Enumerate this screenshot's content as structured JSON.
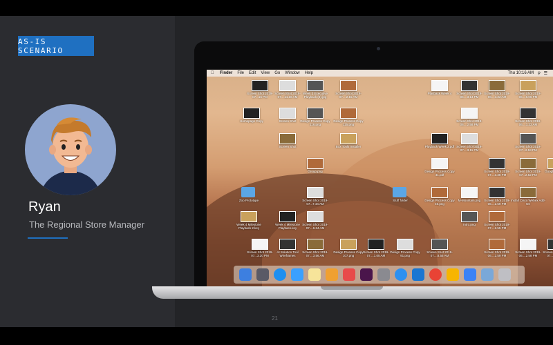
{
  "slide": {
    "tag": "AS-IS SCENARIO",
    "person_name": "Ryan",
    "person_role": "The Regional Store Manager",
    "page_number": "21"
  },
  "menubar": {
    "app_menus": [
      "Finder",
      "File",
      "Edit",
      "View",
      "Go",
      "Window",
      "Help"
    ],
    "clock": "Thu 10:16 AM"
  },
  "desktop": {
    "captions": [
      "Screen Shot 2019-07...16 PM",
      "Screen Shot 2019-07....11.16 AM",
      "Week 3 Executive Playback (3).jpg",
      "Screen Shot 2019-07....2.15 AM",
      "Playback Week 4",
      "Screen Shot 2019-06....3.14 PM",
      "Screen Shot 2019-06....1.22 AM",
      "Screen Shot 2019-06....6.06 PM",
      "Homepage Copy",
      "Screen Shot",
      "Design Process Copy 116.png",
      "Design Process Copy 115.png",
      "Screen Shot 2019-06....2.58 PM",
      "Screen Shot 2019-06....1.23 AM",
      "Screen Shot",
      "Box Tools Installer",
      "Playback Week 2.pdf",
      "Screen Shot 2019-07....3.11 PM",
      "Screen Shot 2019-07...2.53 PM",
      "Group.png",
      "Design Process Copy 41.pdf",
      "Screen Shot 2019-07....3.38 PM",
      "Screen Shot 2019-07...2.52 PM",
      "Google Chrome",
      "Zoo Prototype",
      "Screen Shot 2019-07...7.44 AM",
      "Stuff folder",
      "Design Process Copy 46.png",
      "M-Mountain.png",
      "Screen Shot 2019-06....2.59 PM",
      "Install Cisco Webex Add-On",
      "Week 4 Milestone Playback 2.key",
      "Week 4 Milestone Playback.key",
      "Screen Shot 2019-07....6.34 AM",
      "Intro.png",
      "Screen Shot 2019-07....2.55 PM",
      "Screen Shot 2019-07...3.20 PM",
      "AI Solution Tool Wireframes",
      "Screen Shot 2019-07....3.56 AM",
      "Design Process Copy 107.png",
      "Screen Shot 2019-07....1.05 AM",
      "Design Process Copy 91.png",
      "Screen Shot 2019-07....8.55 AM",
      "Screen Shot 2019-06....2.59 PM",
      "Screen Shot 2019-06....2.58 PM",
      "Screen Shot 2019-07...6.53 AM"
    ]
  },
  "dock": {
    "apps": [
      "finder-icon",
      "launchpad-icon",
      "safari-icon",
      "mail-icon",
      "notes-icon",
      "photos-icon",
      "news-icon",
      "slack-icon",
      "system-preferences-icon",
      "safari-alt-icon",
      "app-store-icon",
      "chrome-icon",
      "sketch-icon",
      "keynote-icon",
      "preview-icon",
      "trash-icon"
    ]
  },
  "colors": {
    "accent": "#1f70c1",
    "background": "#2b2c30",
    "panel": "#232427"
  }
}
